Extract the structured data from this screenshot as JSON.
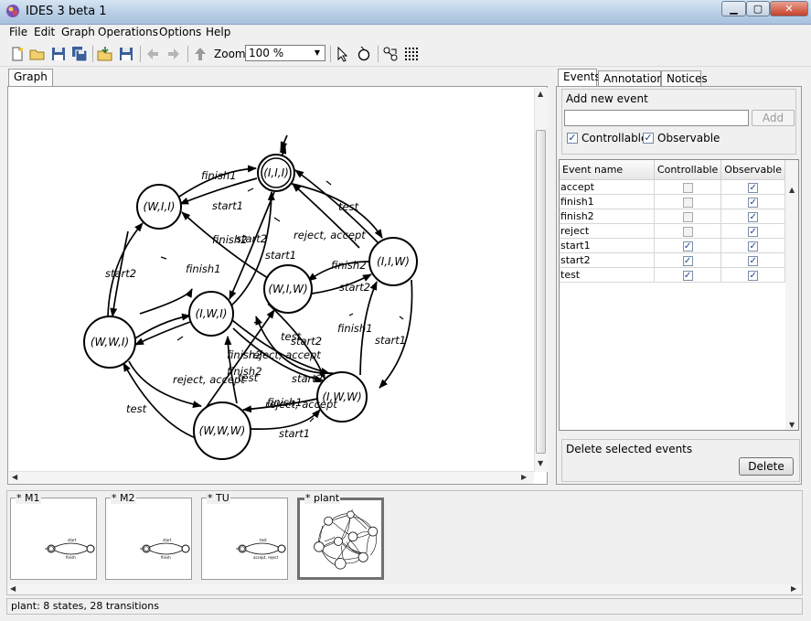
{
  "window": {
    "title": "IDES 3 beta 1"
  },
  "menu": [
    "File",
    "Edit",
    "Graph",
    "Operations",
    "Options",
    "Help"
  ],
  "toolbar": {
    "zoom_label": "Zoom:",
    "zoom_value": "100 %"
  },
  "left_tabs": [
    "Graph"
  ],
  "graph": {
    "states": [
      "(I,I,I)",
      "(W,I,I)",
      "(I,W,I)",
      "(W,I,W)",
      "(I,I,W)",
      "(W,W,I)",
      "(I,W,W)",
      "(W,W,W)"
    ],
    "edge_labels": [
      "finish1",
      "start1",
      "finish2",
      "start2",
      "test",
      "reject, accept",
      "finish1",
      "start1",
      "finish2",
      "start2",
      "reject, accept",
      "test",
      "finish1",
      "start1",
      "finish2",
      "start2",
      "test",
      "reject, accept",
      "finish1",
      "start1",
      "finish2",
      "start2",
      "test",
      "reject, accept",
      "start2"
    ]
  },
  "right_tabs": [
    "Events",
    "Annotations",
    "Notices"
  ],
  "events_panel": {
    "add_title": "Add new event",
    "event_input_value": "",
    "add_button": "Add",
    "controllable_label": "Controllable",
    "controllable_checked": true,
    "observable_label": "Observable",
    "observable_checked": true,
    "columns": [
      "Event name",
      "Controllable",
      "Observable"
    ],
    "rows": [
      {
        "name": "accept",
        "controllable": false,
        "observable": true
      },
      {
        "name": "finish1",
        "controllable": false,
        "observable": true
      },
      {
        "name": "finish2",
        "controllable": false,
        "observable": true
      },
      {
        "name": "reject",
        "controllable": false,
        "observable": true
      },
      {
        "name": "start1",
        "controllable": true,
        "observable": true
      },
      {
        "name": "start2",
        "controllable": true,
        "observable": true
      },
      {
        "name": "test",
        "controllable": true,
        "observable": true
      }
    ],
    "delete_title": "Delete selected events",
    "delete_button": "Delete"
  },
  "thumbnails": [
    {
      "label": "* M1",
      "top_label": "start",
      "bottom_label": "finish",
      "selected": false
    },
    {
      "label": "* M2",
      "top_label": "start",
      "bottom_label": "finish",
      "selected": false
    },
    {
      "label": "* TU",
      "top_label": "test",
      "bottom_label": "accept, reject",
      "selected": false
    },
    {
      "label": "* plant",
      "top_label": "",
      "bottom_label": "",
      "selected": true
    }
  ],
  "status": "plant:  8 states,  28 transitions",
  "colors": {
    "titlebar": "#b9cfe6",
    "close_button": "#c6402a",
    "selected_thumbnail_border": "#707070"
  }
}
